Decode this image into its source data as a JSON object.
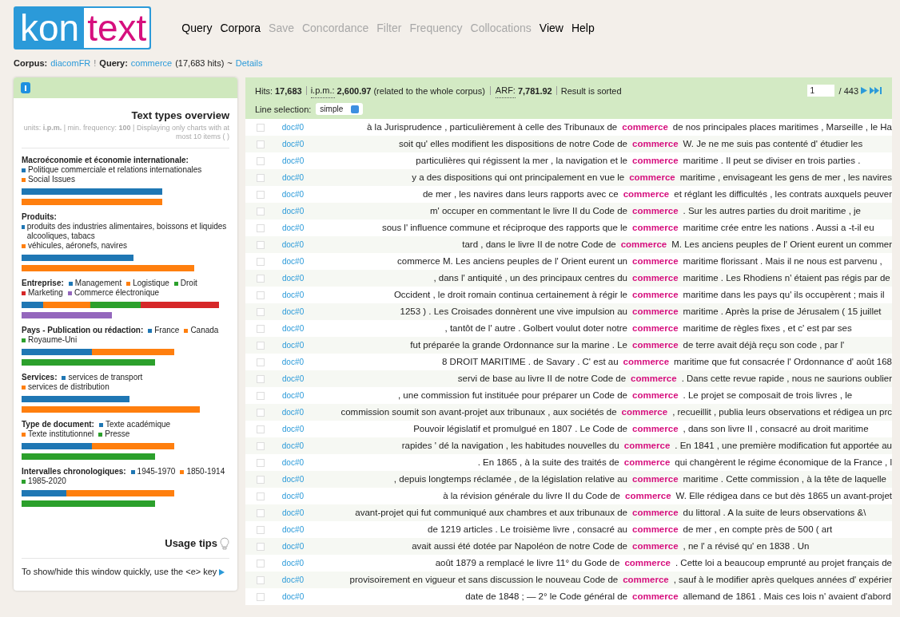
{
  "logo": {
    "part_1": "kon",
    "part_2": "text"
  },
  "nav": [
    {
      "label": "Query",
      "disabled": false
    },
    {
      "label": "Corpora",
      "disabled": false
    },
    {
      "label": "Save",
      "disabled": true
    },
    {
      "label": "Concordance",
      "disabled": true
    },
    {
      "label": "Filter",
      "disabled": true
    },
    {
      "label": "Frequency",
      "disabled": true
    },
    {
      "label": "Collocations",
      "disabled": true
    },
    {
      "label": "View",
      "disabled": false
    },
    {
      "label": "Help",
      "disabled": false
    }
  ],
  "breadcrumb": {
    "corpus_label": "Corpus:",
    "corpus": "diacomFR",
    "separator": "!",
    "query_label": "Query:",
    "query": "commerce",
    "hits": "(17,683 hits)",
    "tilde": "~",
    "details": "Details"
  },
  "sidebar": {
    "title": "Text types overview",
    "note": "units: **i.p.m.** | min. frequency: **100** | Displaying only charts with at most 10 items (  )",
    "sections": [
      {
        "label": "Macroéconomie et économie internationale:",
        "legend": [
          {
            "label": "Politique commerciale et relations internationales",
            "color": "#1f77b4"
          },
          {
            "label": "Social Issues",
            "color": "#ff7f0e"
          }
        ]
      },
      {
        "label": "Produits:",
        "legend": [
          {
            "label": "produits des industries alimentaires, boissons et liquides alcooliques, tabacs",
            "color": "#1f77b4"
          },
          {
            "label": "véhicules, aéronefs, navires",
            "color": "#ff7f0e"
          }
        ]
      },
      {
        "label": "Entreprise:",
        "legend": [
          {
            "label": "Management",
            "color": "#1f77b4"
          },
          {
            "label": "Logistique",
            "color": "#ff7f0e"
          },
          {
            "label": "Droit",
            "color": "#2ca02c"
          },
          {
            "label": "Marketing",
            "color": "#d62728"
          },
          {
            "label": "Commerce électronique",
            "color": "#9467bd"
          }
        ]
      },
      {
        "label": "Pays - Publication ou rédaction:",
        "legend": [
          {
            "label": "France",
            "color": "#1f77b4"
          },
          {
            "label": "Canada",
            "color": "#ff7f0e"
          },
          {
            "label": "Royaume-Uni",
            "color": "#2ca02c"
          }
        ]
      },
      {
        "label": "Services:",
        "legend": [
          {
            "label": "services de transport",
            "color": "#1f77b4"
          },
          {
            "label": "services de distribution",
            "color": "#ff7f0e"
          }
        ]
      },
      {
        "label": "Type de document:",
        "legend": [
          {
            "label": "Texte académique",
            "color": "#1f77b4"
          },
          {
            "label": "Texte institutionnel",
            "color": "#ff7f0e"
          },
          {
            "label": "Presse",
            "color": "#2ca02c"
          }
        ]
      },
      {
        "label": "Intervalles chronologiques:",
        "legend": [
          {
            "label": "1945-1970",
            "color": "#1f77b4"
          },
          {
            "label": "1850-1914",
            "color": "#ff7f0e"
          },
          {
            "label": "1985-2020",
            "color": "#2ca02c"
          }
        ]
      }
    ],
    "usage_tips": "Usage tips",
    "tip": "To show/hide this window quickly, use the <e> key"
  },
  "results": {
    "hits_label": "Hits:",
    "hits": "17,683",
    "ipm_label": "i.p.m.:",
    "ipm": "2,600.97",
    "ipm_note": "(related to the whole corpus)",
    "arf_label": "ARF:",
    "arf": "7,781.92",
    "sorted": "Result is sorted",
    "page": "1",
    "pages": "/ 443",
    "line_selection_label": "Line selection:",
    "line_selection": "simple",
    "rows": [
      {
        "doc": "doc#0",
        "left": "à la Jurisprudence , particulièrement à celle des Tribunaux de",
        "kwic": "commerce",
        "right": "de nos principales places maritimes , Marseille , le Ha",
        "checked": false
      },
      {
        "doc": "doc#0",
        "left": "soit qu' elles modifient les dispositions de notre Code de",
        "kwic": "commerce",
        "right": "W. Je ne me suis pas contenté d' étudier les",
        "checked": false
      },
      {
        "doc": "doc#0",
        "left": "particulières qui régissent la mer , la navigation et le",
        "kwic": "commerce",
        "right": "maritime . Il peut se diviser en trois parties .",
        "checked": false
      },
      {
        "doc": "doc#0",
        "left": "y a des dispositions qui ont principalement en vue le",
        "kwic": "commerce",
        "right": "maritime , envisageant les gens de mer , les navires",
        "checked": false
      },
      {
        "doc": "doc#0",
        "left": "de mer , les navires dans leurs rapports avec ce",
        "kwic": "commerce",
        "right": "et réglant les difficultés , les contrats auxquels peuver",
        "checked": false
      },
      {
        "doc": "doc#0",
        "left": "m' occuper en commentant le livre II du Code de",
        "kwic": "commerce",
        "right": ". Sur les autres parties du droit maritime , je",
        "checked": false
      },
      {
        "doc": "doc#0",
        "left": "sous l' influence commune et réciproque des rapports que le",
        "kwic": "commerce",
        "right": "maritime crée entre les nations . Aussi a -t-il eu",
        "checked": false
      },
      {
        "doc": "doc#0",
        "left": "tard , dans le livre II de notre Code de",
        "kwic": "commerce",
        "right": "M. Les anciens peuples de l' Orient eurent un commer",
        "checked": false
      },
      {
        "doc": "doc#0",
        "left": "commerce M. Les anciens peuples de l' Orient eurent un",
        "kwic": "commerce",
        "right": "maritime florissant . Mais il ne nous est parvenu ,",
        "checked": false
      },
      {
        "doc": "doc#0",
        "left": ", dans l' antiquité , un des principaux centres du",
        "kwic": "commerce",
        "right": "maritime . Les Rhodiens n' étaient pas régis par de",
        "checked": false
      },
      {
        "doc": "doc#0",
        "left": "Occident , le droit romain continua certainement à régir le",
        "kwic": "commerce",
        "right": "maritime dans les pays qu' ils occupèrent ; mais il",
        "checked": false
      },
      {
        "doc": "doc#0",
        "left": "1253 ) . Les Croisades donnèrent une vive impulsion au",
        "kwic": "commerce",
        "right": "maritime . Après la prise de Jérusalem ( 15 juillet",
        "checked": false
      },
      {
        "doc": "doc#0",
        "left": ", tantôt de l' autre . Golbert voulut doter notre",
        "kwic": "commerce",
        "right": "maritime de règles fixes , et c' est par ses",
        "checked": false
      },
      {
        "doc": "doc#0",
        "left": "fut préparée la grande Ordonnance sur la marine . Le",
        "kwic": "commerce",
        "right": "de terre avait déjà reçu son code , par l'",
        "checked": false
      },
      {
        "doc": "doc#0",
        "left": "8 DROIT MARITIME . de Savary . C' est au",
        "kwic": "commerce",
        "right": "maritime que fut consacrée l' Ordonnance d' août 168",
        "checked": false
      },
      {
        "doc": "doc#0",
        "left": "servi de base au livre II de notre Code de",
        "kwic": "commerce",
        "right": ". Dans cette revue rapide , nous ne saurions oublier",
        "checked": false
      },
      {
        "doc": "doc#0",
        "left": ", une commission fut instituée pour préparer un Code de",
        "kwic": "commerce",
        "right": ". Le projet se composait de trois livres , le",
        "checked": false
      },
      {
        "doc": "doc#0",
        "left": "commission soumit son avant-projet aux tribunaux , aux sociétés de",
        "kwic": "commerce",
        "right": ", recueillit , publia leurs observations et rédigea un prc",
        "checked": false
      },
      {
        "doc": "doc#0",
        "left": "Pouvoir législatif et promulgué en 1807 . Le Code de",
        "kwic": "commerce",
        "right": ", dans son livre II , consacré au droit maritime",
        "checked": false
      },
      {
        "doc": "doc#0",
        "left": "rapides ' dé la navigation , les habitudes nouvelles du",
        "kwic": "commerce",
        "right": ". En 1841 , une première modification fut apportée au",
        "checked": false
      },
      {
        "doc": "doc#0",
        "left": ". En 1865 , à la suite des traités de",
        "kwic": "commerce",
        "right": "qui changèrent le régime économique de la France , l",
        "checked": false
      },
      {
        "doc": "doc#0",
        "left": ", depuis longtemps réclamée , de la législation relative au",
        "kwic": "commerce",
        "right": "maritime . Cette commission , à la tête de laquelle",
        "checked": false
      },
      {
        "doc": "doc#0",
        "left": "à la révision générale du livre II du Code de",
        "kwic": "commerce",
        "right": "W. Elle rédigea dans ce but dès 1865 un avant-projet",
        "checked": false
      },
      {
        "doc": "doc#0",
        "left": "avant-projet qui fut communiqué aux chambres et aux tribunaux de",
        "kwic": "commerce",
        "right": "du littoral . A la suite de leurs observations &\\",
        "checked": false
      },
      {
        "doc": "doc#0",
        "left": "de 1219 articles . Le troisième livre , consacré au",
        "kwic": "commerce",
        "right": "de mer , en compte près de 500 ( art",
        "checked": false
      },
      {
        "doc": "doc#0",
        "left": "avait aussi été dotée par Napoléon de notre Code de",
        "kwic": "commerce",
        "right": ", ne l' a révisé qu' en 1838 . Un",
        "checked": false
      },
      {
        "doc": "doc#0",
        "left": "août 1879 a remplacé le livre 11° du Gode de",
        "kwic": "commerce",
        "right": ". Cette loi a beaucoup emprunté au projet français de",
        "checked": false
      },
      {
        "doc": "doc#0",
        "left": "provisoirement en vigueur et sans discussion le nouveau Code de",
        "kwic": "commerce",
        "right": ", sauf à le modifier après quelques années d' expérier",
        "checked": false
      },
      {
        "doc": "doc#0",
        "left": "date de 1848 ; — 2° le Code général de",
        "kwic": "commerce",
        "right": "allemand de 1861 . Mais ces lois n' avaient d'abord",
        "checked": false
      }
    ]
  }
}
